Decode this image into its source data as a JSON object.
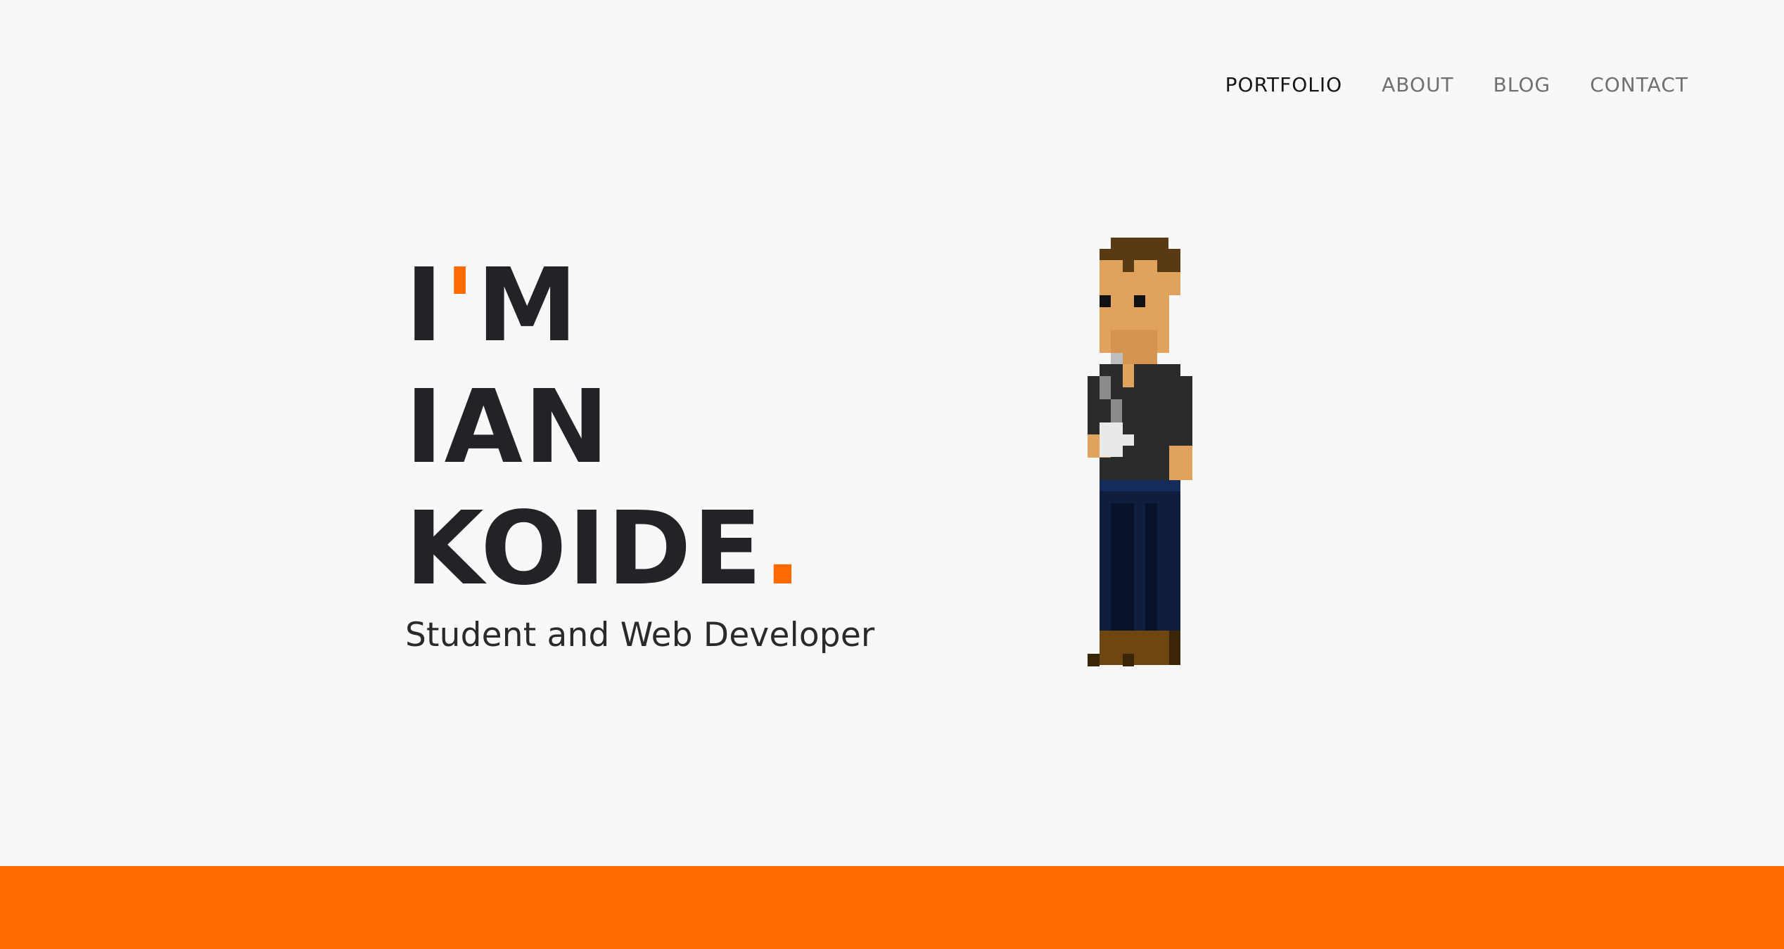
{
  "nav": {
    "items": [
      {
        "label": "PORTFOLIO",
        "active": true
      },
      {
        "label": "ABOUT",
        "active": false
      },
      {
        "label": "BLOG",
        "active": false
      },
      {
        "label": "CONTACT",
        "active": false
      }
    ]
  },
  "hero": {
    "line1_prefix": "I",
    "line1_accent": "'",
    "line1_suffix": "M",
    "line2": "IAN",
    "line3": "KOIDE",
    "line3_accent": ".",
    "subtitle": "Student and Web Developer"
  },
  "colors": {
    "accent": "#ff6a00",
    "text": "#222326",
    "background": "#f8f8f8",
    "nav_active": "#161616",
    "nav_inactive": "#707070"
  },
  "icons": {
    "avatar": "pixel-art-person-icon"
  }
}
